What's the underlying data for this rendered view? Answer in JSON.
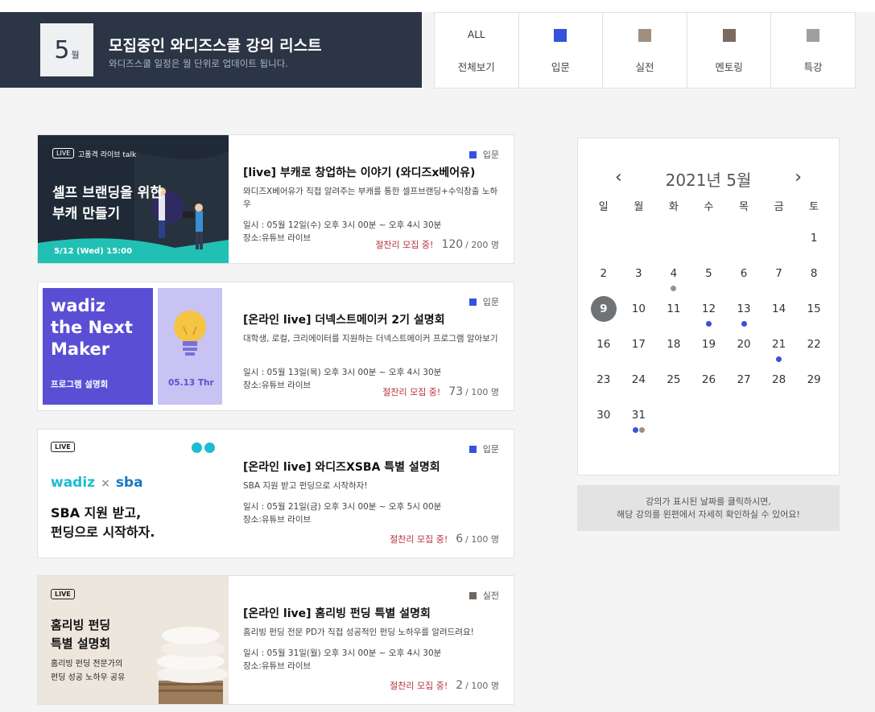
{
  "header": {
    "month_number": "5",
    "month_unit": "월",
    "title": "모집중인 와디즈스쿨 강의 리스트",
    "subtitle": "와디즈스쿨 일정은 월 단위로 업데이트 됩니다."
  },
  "filters": [
    {
      "top": "ALL",
      "label": "전체보기",
      "color": null
    },
    {
      "top": "",
      "label": "입문",
      "color": "#3552dc"
    },
    {
      "top": "",
      "label": "실전",
      "color": "#a08f80"
    },
    {
      "top": "",
      "label": "멘토링",
      "color": "#7a6a60"
    },
    {
      "top": "",
      "label": "특강",
      "color": "#9d9fa2"
    }
  ],
  "cards": [
    {
      "category": "입문",
      "category_color": "#3552dc",
      "title": "[live] 부캐로 창업하는 이야기 (와디즈x베어유)",
      "desc": "와디즈X베어유가 직접 알려주는 부캐를 통한 셀프브랜딩+수익창출 노하우",
      "date": "일시 : 05월 12일(수) 오후 3시 00분 ~ 오후 4시 30분",
      "place": "장소:유튜브 라이브",
      "status": "절찬리 모집 중!",
      "count": "120",
      "capacity": "/ 200 명",
      "thumb": {
        "live": "LIVE",
        "tag": "고품격 라이브 talk",
        "line1": "셀프 브랜딩을 위한",
        "line2": "부캐 만들기",
        "date": "5/12 (Wed) 15:00"
      }
    },
    {
      "category": "입문",
      "category_color": "#3552dc",
      "title": "[온라인 live] 더넥스트메이커 2기 설명회",
      "desc": "대학생, 로컬, 크리에이터를 지원하는 더넥스트메이커 프로그램 알아보기",
      "date": "일시 : 05월 13일(목) 오후 3시 00분 ~ 오후 4시 30분",
      "place": "장소:유튜브 라이브",
      "status": "절찬리 모집 중!",
      "count": "73",
      "capacity": "/ 100 명",
      "thumb": {
        "line1": "wadiz",
        "line2": "the Next",
        "line3": "Maker",
        "label": "프로그램 설명회",
        "date": "05.13 Thr"
      }
    },
    {
      "category": "입문",
      "category_color": "#3552dc",
      "title": "[온라인 live] 와디즈XSBA 특별 설명회",
      "desc": "SBA 지원 받고 펀딩으로 시작하자!",
      "date": "일시 : 05월 21일(금) 오후 3시 00분 ~ 오후 5시 00분",
      "place": "장소:유튜브 라이브",
      "status": "절찬리 모집 중!",
      "count": "6",
      "capacity": "/ 100 명",
      "thumb": {
        "live": "LIVE",
        "brand1": "wadiz",
        "x": "×",
        "brand2": "sba",
        "line1": "SBA 지원 받고,",
        "line2": "펀딩으로 시작하자."
      }
    },
    {
      "category": "실전",
      "category_color": "#6e6660",
      "title": "[온라인 live] 홈리빙 펀딩 특별 설명회",
      "desc": "홈리빙 펀딩 전문 PD가 직접 성공적인 펀딩 노하우를 알려드려요!",
      "date": "일시 : 05월 31일(월) 오후 3시 00분 ~ 오후 4시 30분",
      "place": "장소:유튜브 라이브",
      "status": "절찬리 모집 중!",
      "count": "2",
      "capacity": "/ 100 명",
      "thumb": {
        "live": "LIVE",
        "line1": "홈리빙 펀딩",
        "line2": "특별 설명회",
        "line3": "홈리빙 펀딩 전문가의",
        "line4": "펀딩 성공 노하우 공유"
      }
    }
  ],
  "calendar": {
    "title": "2021년 5월",
    "prev": "‹",
    "next": "›",
    "weekdays": [
      "일",
      "월",
      "화",
      "수",
      "목",
      "금",
      "토"
    ],
    "weeks": [
      [
        "",
        "",
        "",
        "",
        "",
        "",
        "1"
      ],
      [
        "2",
        "3",
        "4",
        "5",
        "6",
        "7",
        "8"
      ],
      [
        "9",
        "10",
        "11",
        "12",
        "13",
        "14",
        "15"
      ],
      [
        "16",
        "17",
        "18",
        "19",
        "20",
        "21",
        "22"
      ],
      [
        "23",
        "24",
        "25",
        "26",
        "27",
        "28",
        "29"
      ],
      [
        "30",
        "31",
        "",
        "",
        "",
        "",
        ""
      ]
    ],
    "selected": "9",
    "marks": {
      "4": [
        "#a08f80"
      ],
      "12": [
        "#3552dc"
      ],
      "13": [
        "#3552dc"
      ],
      "21": [
        "#3552dc"
      ],
      "31": [
        "#3552dc",
        "#a08f80"
      ]
    },
    "note_line1": "강의가 표시된 날짜를 클릭하시면,",
    "note_line2": "해당 강의를 왼편에서 자세히 확인하실 수 있어요!"
  }
}
